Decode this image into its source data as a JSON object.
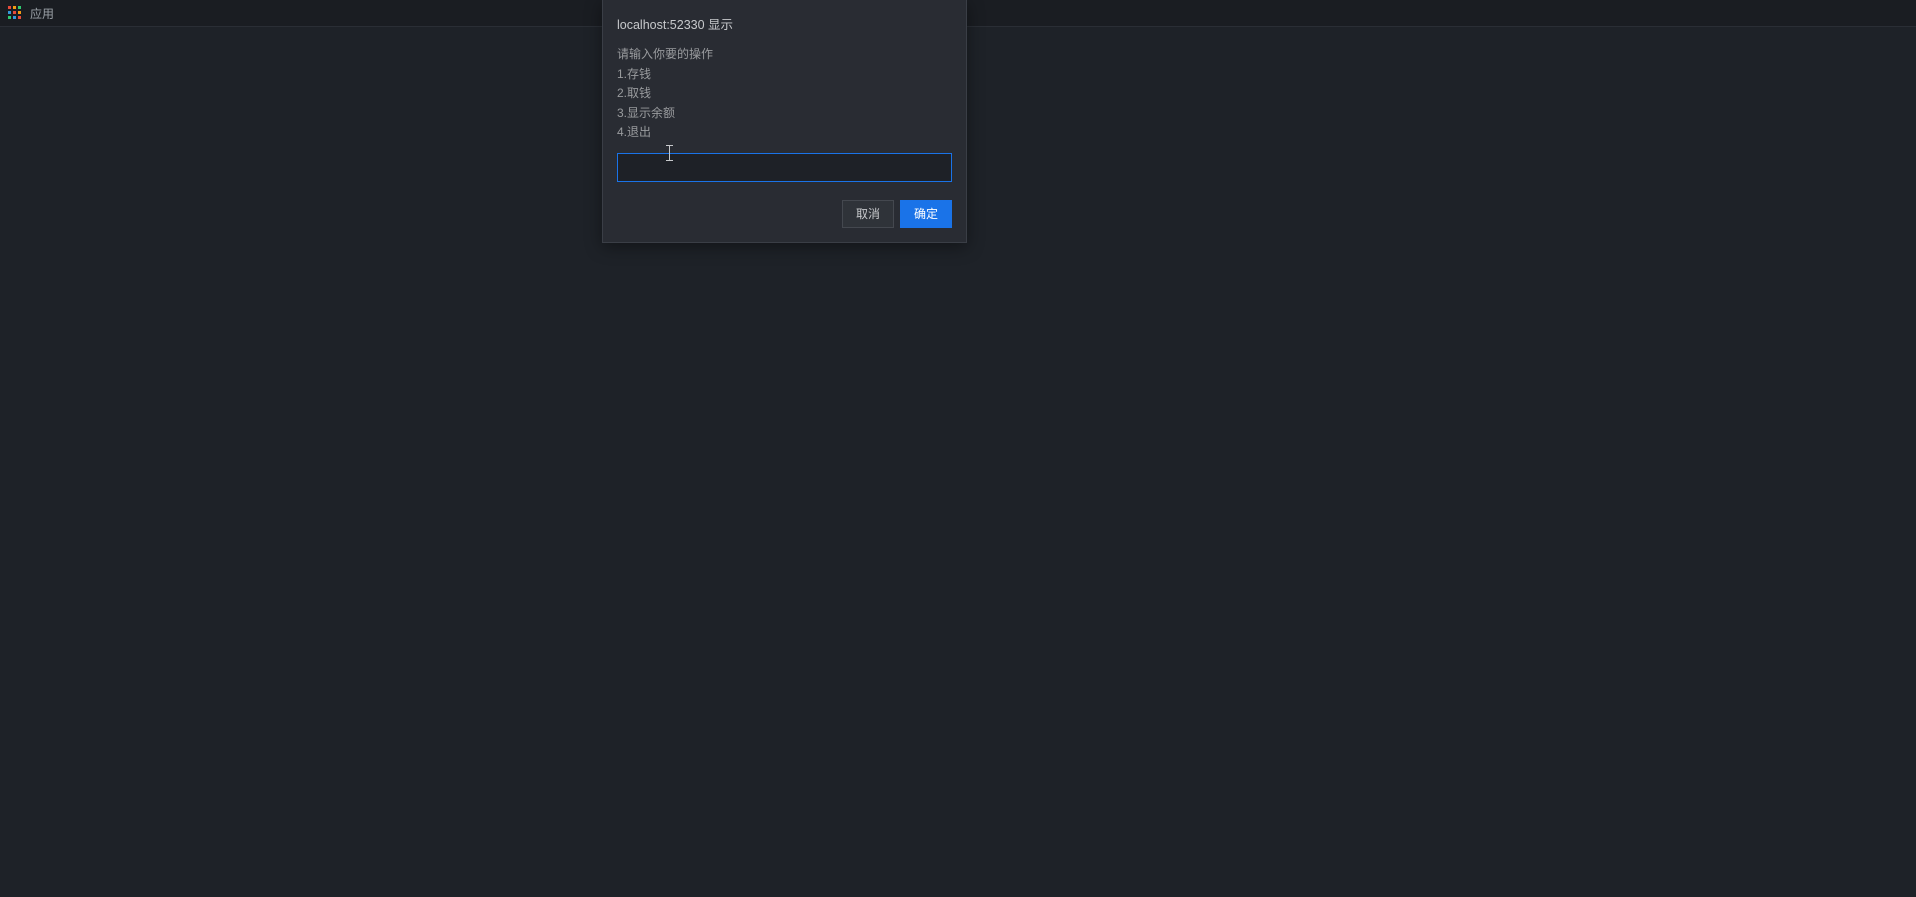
{
  "bookmark_bar": {
    "apps_label": "应用"
  },
  "dialog": {
    "title": "localhost:52330 显示",
    "message_intro": "请输入你要的操作",
    "options": [
      "1.存钱",
      "2.取钱",
      "3.显示余额",
      "4.退出"
    ],
    "input_value": "",
    "cancel_label": "取消",
    "ok_label": "确定"
  }
}
